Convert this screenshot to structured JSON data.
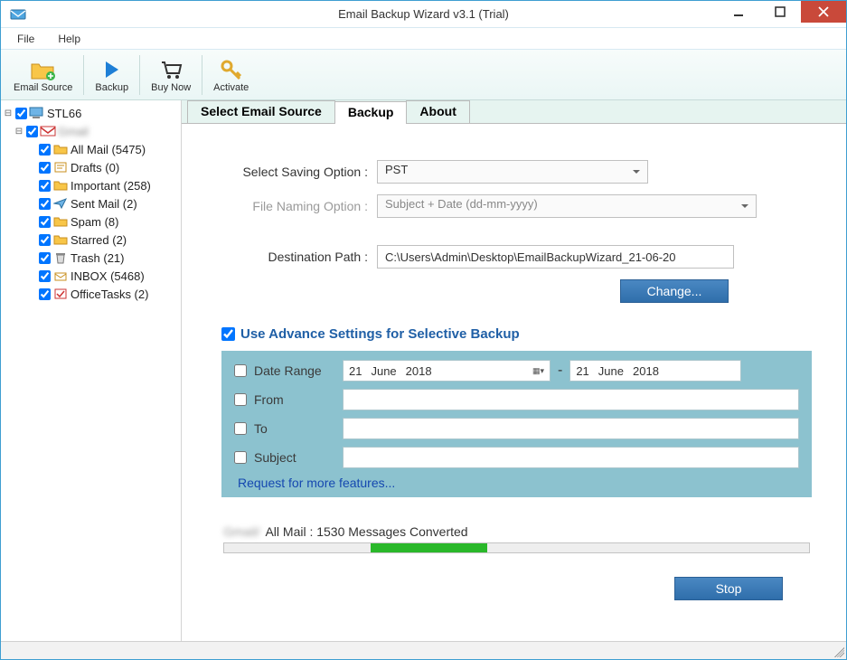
{
  "window": {
    "title": "Email Backup Wizard v3.1 (Trial)"
  },
  "menu": {
    "file": "File",
    "help": "Help"
  },
  "toolbar": {
    "email_source": "Email Source",
    "backup": "Backup",
    "buy_now": "Buy Now",
    "activate": "Activate"
  },
  "tree": {
    "root": "STL66",
    "account": "Gmail",
    "folders": [
      {
        "label": "All Mail (5475)"
      },
      {
        "label": "Drafts (0)"
      },
      {
        "label": "Important (258)"
      },
      {
        "label": "Sent Mail (2)"
      },
      {
        "label": "Spam (8)"
      },
      {
        "label": "Starred (2)"
      },
      {
        "label": "Trash (21)"
      },
      {
        "label": "INBOX (5468)"
      },
      {
        "label": "OfficeTasks (2)"
      }
    ]
  },
  "tabs": {
    "select_source": "Select Email Source",
    "backup": "Backup",
    "about": "About"
  },
  "form": {
    "saving_label": "Select Saving Option :",
    "saving_value": "PST",
    "naming_label": "File Naming Option :",
    "naming_value": "Subject + Date (dd-mm-yyyy)",
    "dest_label": "Destination Path :",
    "dest_value": "C:\\Users\\Admin\\Desktop\\EmailBackupWizard_21-06-20",
    "change_btn": "Change..."
  },
  "advance": {
    "title": "Use Advance Settings for Selective Backup",
    "date_range": "Date Range",
    "from": "From",
    "to": "To",
    "subject": "Subject",
    "date1_d": "21",
    "date1_m": "June",
    "date1_y": "2018",
    "date2_d": "21",
    "date2_m": "June",
    "date2_y": "2018",
    "request_link": "Request for more features..."
  },
  "status": {
    "text": "All Mail : 1530 Messages Converted",
    "stop_btn": "Stop"
  }
}
